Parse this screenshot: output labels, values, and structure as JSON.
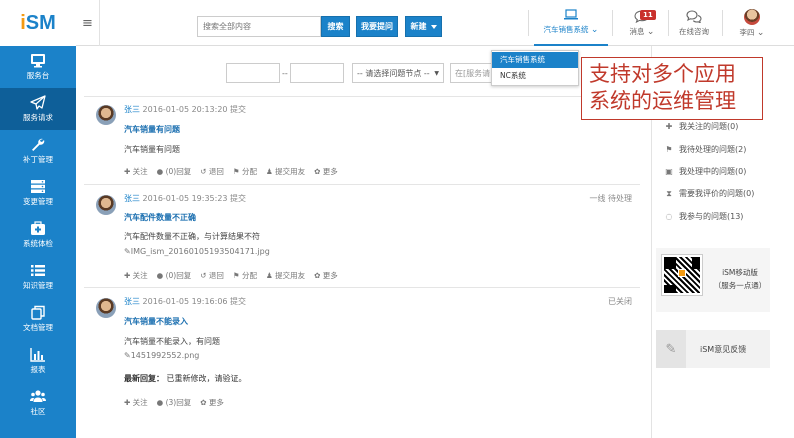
{
  "logo": {
    "i": "i",
    "sm": "SM"
  },
  "header": {
    "search_placeholder": "搜索全部内容",
    "search_button": "搜索",
    "ask_button": "我要提问",
    "new_button": "新建",
    "app_switch_label": "汽车销售系统",
    "messages_label": "消息",
    "messages_badge": "11",
    "consult_label": "在线咨询",
    "user_name": "李四"
  },
  "app_dropdown": {
    "items": [
      "汽车销售系统",
      "NC系统"
    ],
    "selected": "汽车销售系统"
  },
  "callout": {
    "line1": "支持对多个应用",
    "line2": "系统的运维管理"
  },
  "sidebar": {
    "items": [
      {
        "label": "服务台",
        "icon": "monitor-icon"
      },
      {
        "label": "服务请求",
        "icon": "paper-plane-icon"
      },
      {
        "label": "补丁管理",
        "icon": "wrench-icon"
      },
      {
        "label": "变更管理",
        "icon": "server-icon"
      },
      {
        "label": "系统体检",
        "icon": "medical-kit-icon"
      },
      {
        "label": "知识管理",
        "icon": "list-icon"
      },
      {
        "label": "文档管理",
        "icon": "documents-icon"
      },
      {
        "label": "报表",
        "icon": "bar-chart-icon"
      },
      {
        "label": "社区",
        "icon": "users-icon"
      }
    ],
    "active_index": 1
  },
  "filters": {
    "range_sep": "--",
    "node_select": "-- 请选择问题节点 --",
    "system_placeholder": "在[服务请"
  },
  "posts": [
    {
      "author": "张三",
      "time": "2016-01-05 20:13:20 提交",
      "title": "汽车销量有问题",
      "body": "汽车销量有问题",
      "status": "",
      "actions": [
        "关注",
        "(0)回复",
        "退回",
        "分配",
        "提交用友",
        "更多"
      ]
    },
    {
      "author": "张三",
      "time": "2016-01-05 19:35:23 提交",
      "title": "汽车配件数量不正确",
      "body": "汽车配件数量不正确，与计算结果不符",
      "file": "IMG_ism_20160105193504171.jpg",
      "status": "一线 待处理",
      "actions": [
        "关注",
        "(0)回复",
        "退回",
        "分配",
        "提交用友",
        "更多"
      ]
    },
    {
      "author": "张三",
      "time": "2016-01-05 19:16:06 提交",
      "title": "汽车销量不能录入",
      "body": "汽车销量不能录入，有问题",
      "file": "1451992552.png",
      "reply_label": "最新回复：",
      "reply_text": "已重新修改，请验证。",
      "status": "已关闭",
      "actions": [
        "关注",
        "(3)回复",
        "更多"
      ]
    }
  ],
  "right_panel": {
    "links": [
      "我关注的问题(0)",
      "我待处理的问题(2)",
      "我处理中的问题(0)",
      "需要我评价的问题(0)",
      "我参与的问题(13)"
    ],
    "qr_line1": "iSM移动版",
    "qr_line2": "（服务一点通）",
    "feedback": "iSM意见反馈"
  },
  "colors": {
    "brand_blue": "#1b82c9",
    "logo_orange": "#f39a12",
    "callout_red": "#c0392b"
  }
}
